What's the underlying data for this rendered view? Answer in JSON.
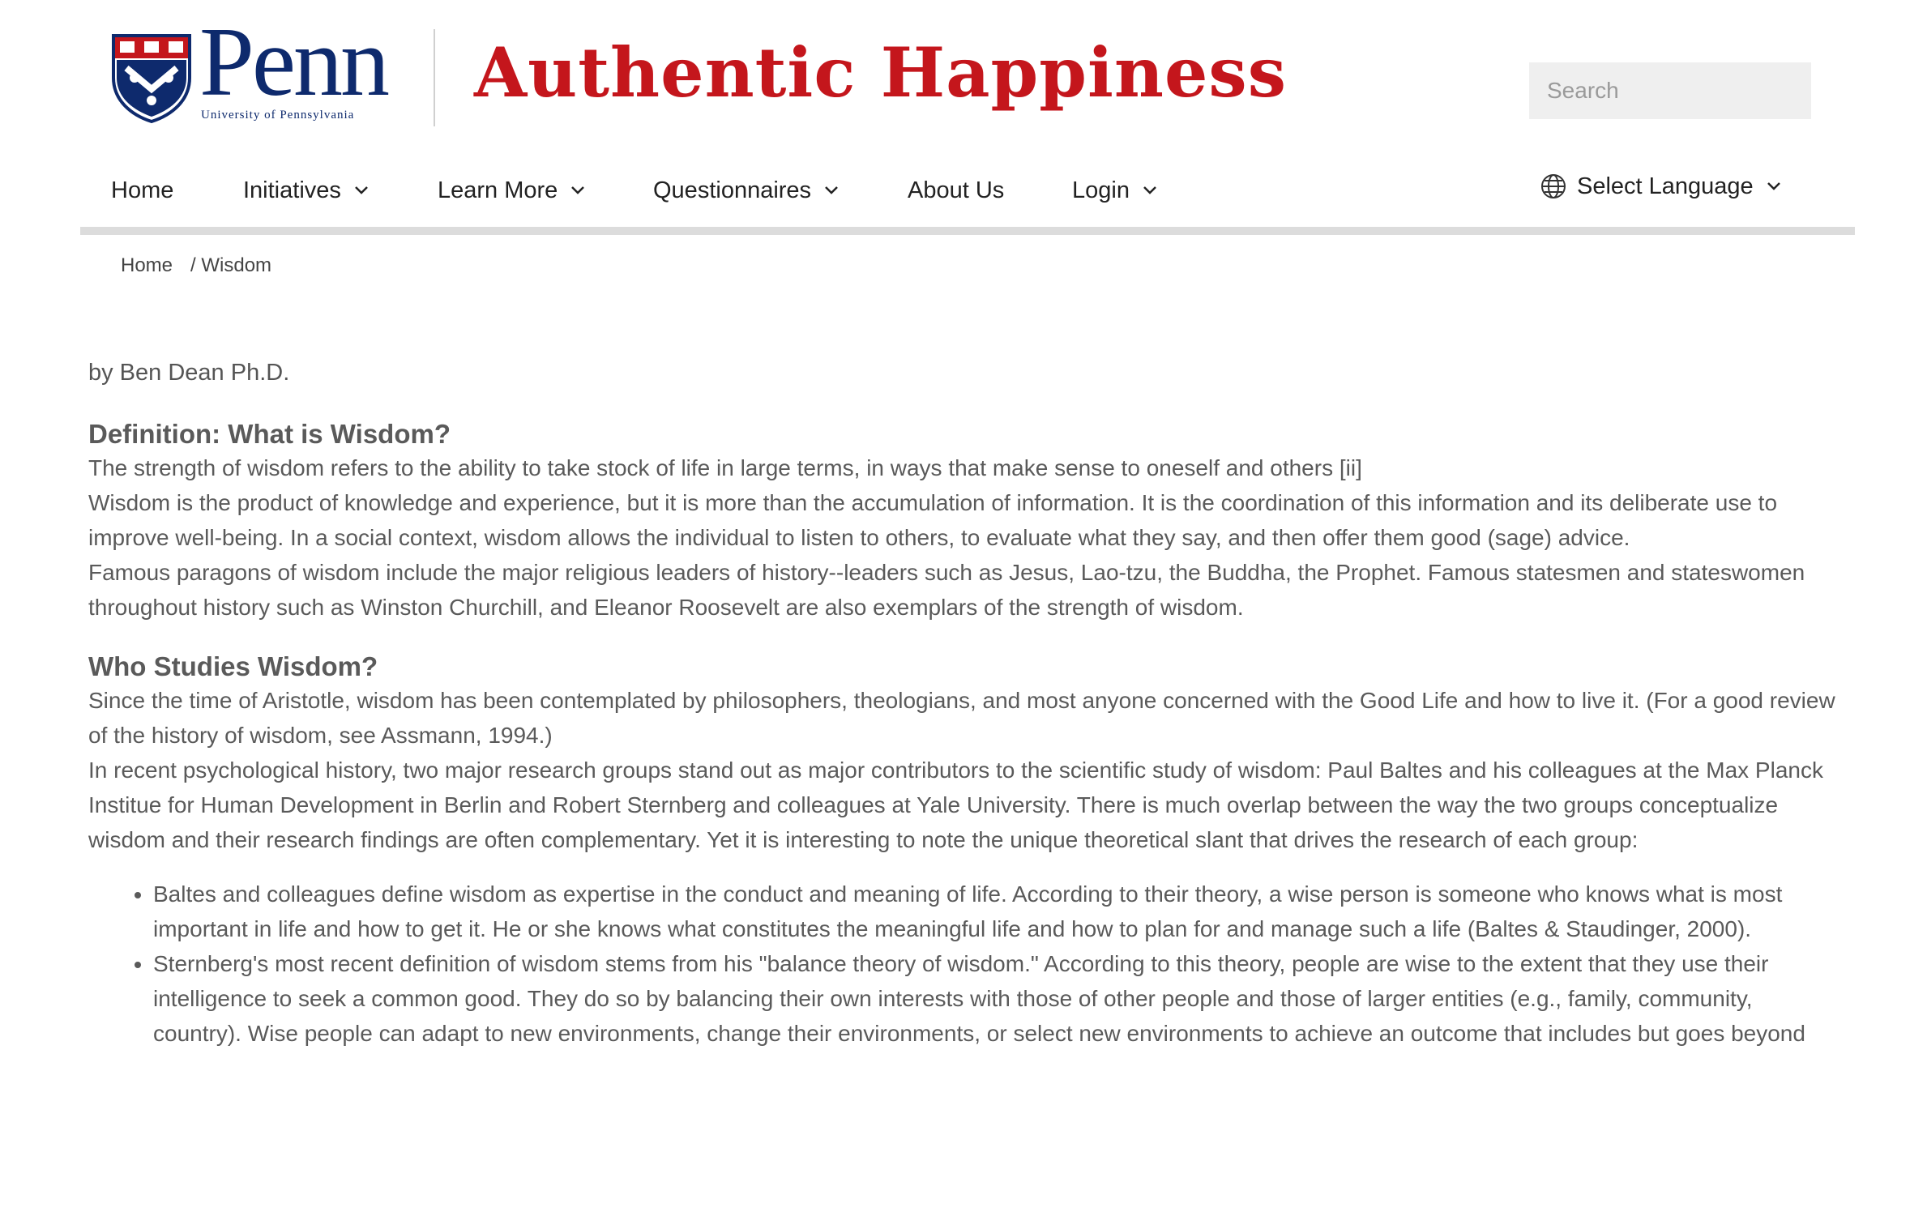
{
  "header": {
    "logo": {
      "word": "Penn",
      "subtitle": "University of Pennsylvania",
      "brand_color": "#0e2a6d"
    },
    "site_title": "Authentic Happiness",
    "title_color": "#c4161c",
    "search": {
      "placeholder": "Search"
    }
  },
  "nav": {
    "items": [
      {
        "label": "Home",
        "dropdown": false
      },
      {
        "label": "Initiatives",
        "dropdown": true
      },
      {
        "label": "Learn More",
        "dropdown": true
      },
      {
        "label": "Questionnaires",
        "dropdown": true
      },
      {
        "label": "About Us",
        "dropdown": false
      },
      {
        "label": "Login",
        "dropdown": true
      }
    ],
    "language": {
      "label": "Select Language",
      "icon": "globe-icon"
    }
  },
  "breadcrumb": {
    "home": "Home",
    "current": "/ Wisdom"
  },
  "article": {
    "byline": "by Ben Dean Ph.D.",
    "heading_definition": "Definition: What is Wisdom?",
    "para1": "The strength of wisdom refers to the ability to take stock of life in large terms, in ways that make sense to oneself and others [ii]",
    "para2": "Wisdom is the product of knowledge and experience, but it is more than the accumulation of information. It is the coordination of this information and its deliberate use to improve well-being.  In a social context, wisdom allows the individual to listen to others, to evaluate what they say, and then offer them good (sage) advice.",
    "para3": "Famous paragons of wisdom include the major religious leaders of history--leaders such as Jesus, Lao-tzu, the Buddha, the Prophet.  Famous statesmen and stateswomen throughout history such as Winston Churchill, and Eleanor Roosevelt are also exemplars of the strength of wisdom.",
    "heading_who": "Who Studies Wisdom?",
    "para4": "Since the time of Aristotle, wisdom has been contemplated by philosophers, theologians, and most anyone concerned with the Good Life and how to live it. (For a good review of the history of wisdom, see Assmann, 1994.)",
    "para5": "In recent psychological history, two major research groups stand out as major contributors to the scientific study of wisdom: Paul Baltes and his colleagues at the Max Planck Institue for Human Development in Berlin and Robert Sternberg and colleagues at Yale University.  There is much overlap between the way the two groups conceptualize wisdom and their research findings are often complementary.  Yet it is interesting to note the unique theoretical slant that drives the research of each group:",
    "bullets": [
      "Baltes and colleagues define wisdom as expertise in the conduct and meaning of life.  According to their theory, a wise person is someone who knows what is most important in life and how to get it.  He or she knows what constitutes the meaningful life and how to plan for and manage such a life (Baltes & Staudinger, 2000).",
      "Sternberg's most recent definition of wisdom stems from his \"balance theory of wisdom.\"  According to this theory, people are wise to the extent that they use their intelligence to seek a common good.  They do so by balancing their own interests with those of other people and those of larger entities (e.g., family, community, country).  Wise people can adapt to new environments, change their environments, or select new environments to achieve an outcome that includes but goes beyond"
    ]
  }
}
